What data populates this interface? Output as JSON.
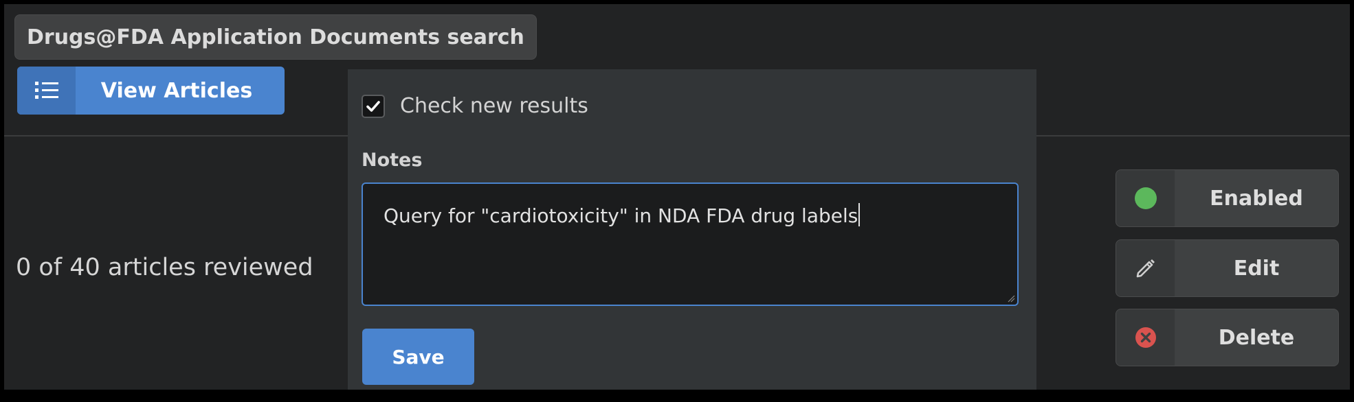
{
  "header": {
    "title": "Drugs@FDA Application Documents search",
    "view_articles_label": "View Articles"
  },
  "status": {
    "reviewed_text": "0 of 40 articles reviewed"
  },
  "panel": {
    "check_new_results_label": "Check new results",
    "check_new_results_checked": true,
    "notes_label": "Notes",
    "notes_value": "Query for \"cardiotoxicity\" in NDA FDA drug labels",
    "save_label": "Save"
  },
  "actions": {
    "enabled_label": "Enabled",
    "edit_label": "Edit",
    "delete_label": "Delete"
  },
  "colors": {
    "accent_blue": "#4a84cf",
    "enabled_green": "#5cb85c",
    "delete_red": "#d9534f"
  }
}
